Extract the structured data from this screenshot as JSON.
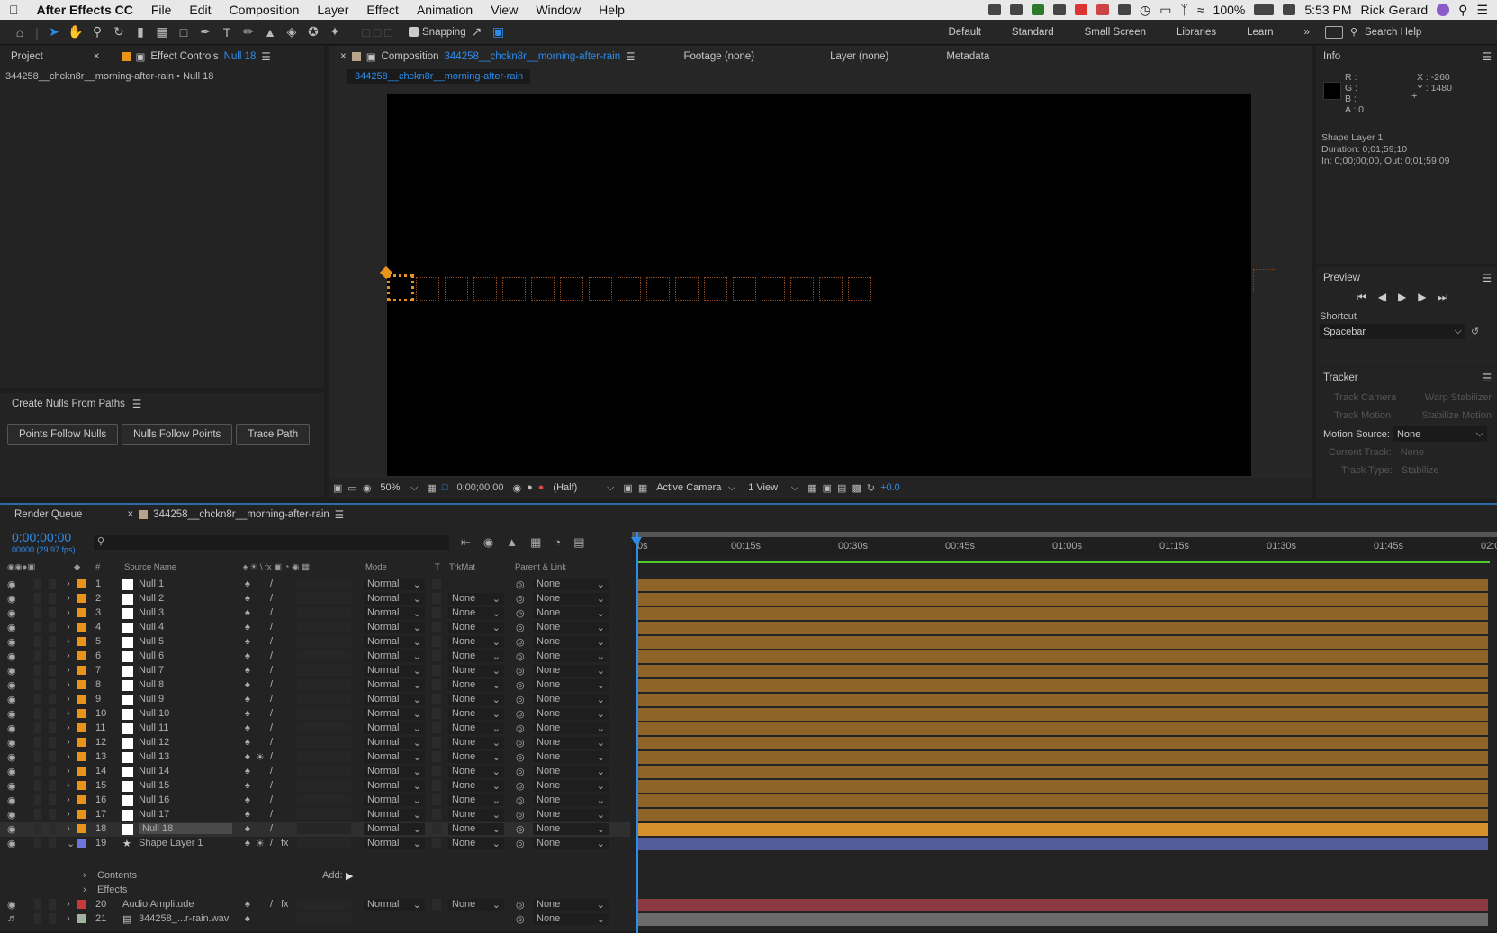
{
  "menubar": {
    "app": "After Effects CC",
    "items": [
      "File",
      "Edit",
      "Composition",
      "Layer",
      "Effect",
      "Animation",
      "View",
      "Window",
      "Help"
    ],
    "battery": "100%",
    "time": "5:53 PM",
    "user": "Rick Gerard"
  },
  "toolbar": {
    "snapping": "Snapping",
    "workspaces": [
      "Default",
      "Standard",
      "Small Screen",
      "Libraries",
      "Learn"
    ],
    "search": "Search Help"
  },
  "left_panel": {
    "tab_project": "Project",
    "tab_effect_label": "Effect Controls",
    "tab_effect_layer": "Null 18",
    "breadcrumb": "344258__chckn8r__morning-after-rain • Null 18",
    "script_title": "Create Nulls From Paths",
    "buttons": [
      "Points Follow Nulls",
      "Nulls Follow Points",
      "Trace Path"
    ]
  },
  "viewer": {
    "tab_comp_label": "Composition",
    "tab_comp_name": "344258__chckn8r__morning-after-rain",
    "tab_footage": "Footage (none)",
    "tab_layer": "Layer (none)",
    "tab_metadata": "Metadata",
    "comp_chip": "344258__chckn8r__morning-after-rain",
    "zoom": "50%",
    "timecode": "0;00;00;00",
    "resolution": "(Half)",
    "camera": "Active Camera",
    "views": "1 View",
    "exposure": "+0.0"
  },
  "info": {
    "title": "Info",
    "r": "R :",
    "g": "G :",
    "b": "B :",
    "a": "A :  0",
    "x": "X : -260",
    "y": "Y : 1480",
    "layer_name": "Shape Layer 1",
    "duration": "Duration: 0;01;59;10",
    "inout": "In: 0;00;00;00, Out: 0;01;59;09"
  },
  "preview": {
    "title": "Preview",
    "shortcut_label": "Shortcut",
    "shortcut_value": "Spacebar"
  },
  "tracker": {
    "title": "Tracker",
    "track_camera": "Track Camera",
    "warp_stabilizer": "Warp Stabilizer",
    "track_motion": "Track Motion",
    "stabilize_motion": "Stabilize Motion",
    "motion_source_label": "Motion Source:",
    "motion_source_value": "None",
    "current_track_label": "Current Track:",
    "current_track_value": "None",
    "track_type_label": "Track Type:",
    "track_type_value": "Stabilize"
  },
  "timeline": {
    "tab_render": "Render Queue",
    "tab_comp": "344258__chckn8r__morning-after-rain",
    "timecode": "0;00;00;00",
    "fps": "00000 (29.97 fps)",
    "headers": {
      "num": "#",
      "source": "Source Name",
      "mode": "Mode",
      "t": "T",
      "trkmat": "TrkMat",
      "parent": "Parent & Link"
    },
    "ruler": [
      "0s",
      "00:15s",
      "00:30s",
      "00:45s",
      "01:00s",
      "01:15s",
      "01:30s",
      "01:45s",
      "02:0"
    ],
    "layers": [
      {
        "num": "1",
        "name": "Null 1",
        "mode": "Normal",
        "trk": "",
        "parent": "None",
        "label": "#e8941a",
        "bar": "#8f6428"
      },
      {
        "num": "2",
        "name": "Null 2",
        "mode": "Normal",
        "trk": "None",
        "parent": "None",
        "label": "#e8941a",
        "bar": "#8f6428"
      },
      {
        "num": "3",
        "name": "Null 3",
        "mode": "Normal",
        "trk": "None",
        "parent": "None",
        "label": "#e8941a",
        "bar": "#8f6428"
      },
      {
        "num": "4",
        "name": "Null 4",
        "mode": "Normal",
        "trk": "None",
        "parent": "None",
        "label": "#e8941a",
        "bar": "#8f6428"
      },
      {
        "num": "5",
        "name": "Null 5",
        "mode": "Normal",
        "trk": "None",
        "parent": "None",
        "label": "#e8941a",
        "bar": "#8f6428"
      },
      {
        "num": "6",
        "name": "Null 6",
        "mode": "Normal",
        "trk": "None",
        "parent": "None",
        "label": "#e8941a",
        "bar": "#8f6428"
      },
      {
        "num": "7",
        "name": "Null 7",
        "mode": "Normal",
        "trk": "None",
        "parent": "None",
        "label": "#e8941a",
        "bar": "#8f6428"
      },
      {
        "num": "8",
        "name": "Null 8",
        "mode": "Normal",
        "trk": "None",
        "parent": "None",
        "label": "#e8941a",
        "bar": "#8f6428"
      },
      {
        "num": "9",
        "name": "Null 9",
        "mode": "Normal",
        "trk": "None",
        "parent": "None",
        "label": "#e8941a",
        "bar": "#8f6428"
      },
      {
        "num": "10",
        "name": "Null 10",
        "mode": "Normal",
        "trk": "None",
        "parent": "None",
        "label": "#e8941a",
        "bar": "#8f6428"
      },
      {
        "num": "11",
        "name": "Null 11",
        "mode": "Normal",
        "trk": "None",
        "parent": "None",
        "label": "#e8941a",
        "bar": "#8f6428"
      },
      {
        "num": "12",
        "name": "Null 12",
        "mode": "Normal",
        "trk": "None",
        "parent": "None",
        "label": "#e8941a",
        "bar": "#8f6428"
      },
      {
        "num": "13",
        "name": "Null 13",
        "mode": "Normal",
        "trk": "None",
        "parent": "None",
        "label": "#e8941a",
        "bar": "#8f6428"
      },
      {
        "num": "14",
        "name": "Null 14",
        "mode": "Normal",
        "trk": "None",
        "parent": "None",
        "label": "#e8941a",
        "bar": "#8f6428"
      },
      {
        "num": "15",
        "name": "Null 15",
        "mode": "Normal",
        "trk": "None",
        "parent": "None",
        "label": "#e8941a",
        "bar": "#8f6428"
      },
      {
        "num": "16",
        "name": "Null 16",
        "mode": "Normal",
        "trk": "None",
        "parent": "None",
        "label": "#e8941a",
        "bar": "#8f6428"
      },
      {
        "num": "17",
        "name": "Null 17",
        "mode": "Normal",
        "trk": "None",
        "parent": "None",
        "label": "#e8941a",
        "bar": "#8f6428"
      },
      {
        "num": "18",
        "name": "Null 18",
        "mode": "Normal",
        "trk": "None",
        "parent": "None",
        "label": "#e8941a",
        "bar": "#d4902a"
      },
      {
        "num": "19",
        "name": "Shape Layer 1",
        "mode": "Normal",
        "trk": "None",
        "parent": "None",
        "label": "#6b76d8",
        "bar": "#545c9a"
      }
    ],
    "sub_contents": "Contents",
    "sub_effects": "Effects",
    "add_label": "Add:",
    "layers_bottom": [
      {
        "num": "20",
        "name": "Audio Amplitude",
        "mode": "Normal",
        "trk": "None",
        "parent": "None",
        "label": "#c83a3a",
        "bar": "#8a3a40"
      },
      {
        "num": "21",
        "name": "344258_...r-rain.wav",
        "mode": "",
        "trk": "",
        "parent": "None",
        "label": "#9fb39f",
        "bar": "#6b6b6b"
      }
    ]
  }
}
